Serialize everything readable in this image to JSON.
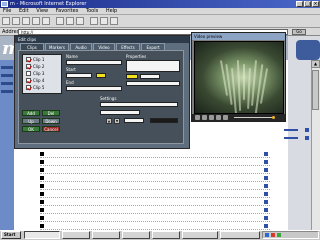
{
  "browser": {
    "title": "m - Microsoft Internet Explorer",
    "menu": [
      "File",
      "Edit",
      "View",
      "Favorites",
      "Tools",
      "Help"
    ],
    "address_label": "Address",
    "address_value": "http://",
    "go_label": "Go",
    "window_buttons": [
      "_",
      "□",
      "×"
    ]
  },
  "site": {
    "logo": "m"
  },
  "player": {
    "title": "Edit clips",
    "tabs": [
      "Clips",
      "Markers",
      "Audio",
      "Video",
      "Effects",
      "Export"
    ],
    "clips": [
      "Clip 1",
      "Clip 2",
      "Clip 3",
      "Clip 4",
      "Clip 5"
    ],
    "clip_checked": [
      true,
      true,
      false,
      true,
      true
    ],
    "fields": {
      "name_label": "Name",
      "name_value": "",
      "start_label": "Start",
      "start_value": "",
      "end_label": "End",
      "end_value": ""
    },
    "props": {
      "label": "Properties",
      "value": ""
    },
    "settings_label": "Settings",
    "buttons": [
      "Add",
      "Del",
      "Up",
      "Down",
      "OK",
      "Cancel"
    ]
  },
  "video": {
    "title": "Video preview",
    "strand_count": 9
  },
  "content_rows": [
    {
      "title": "",
      "desc": "",
      "size": ""
    },
    {
      "title": "",
      "desc": "",
      "size": ""
    },
    {
      "title": "",
      "desc": "",
      "size": ""
    },
    {
      "title": "",
      "desc": "",
      "size": ""
    },
    {
      "title": "",
      "desc": "",
      "size": ""
    },
    {
      "title": "",
      "desc": "",
      "size": ""
    },
    {
      "title": "",
      "desc": "",
      "size": ""
    },
    {
      "title": "",
      "desc": "",
      "size": ""
    },
    {
      "title": "",
      "desc": "",
      "size": ""
    },
    {
      "title": "",
      "desc": "",
      "size": ""
    }
  ],
  "taskbar": {
    "start_label": "Start",
    "tasks": [
      "",
      "",
      "",
      "",
      "",
      "",
      ""
    ],
    "clock": ""
  },
  "colors": {
    "title_bar": "#1c2c8a",
    "site_header": "#a9b4c4",
    "nav": "#6c8bc7",
    "player_bg": "#5e6e7e",
    "link": "#0000c0",
    "button_green": "#3a7a3a",
    "highlight_yellow": "#f0e020"
  }
}
